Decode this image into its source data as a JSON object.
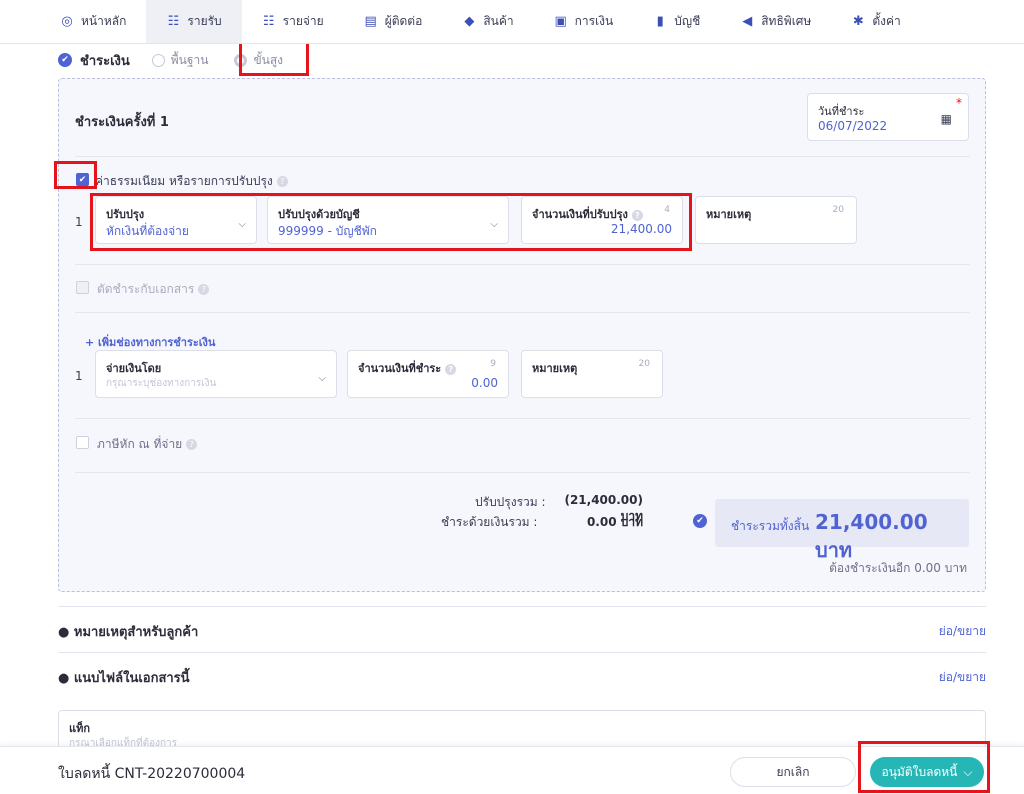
{
  "nav": {
    "items": [
      {
        "label": "หน้าหลัก",
        "icon": "dashboard-icon",
        "glyph": "◎"
      },
      {
        "label": "รายรับ",
        "icon": "income-icon",
        "glyph": "☷"
      },
      {
        "label": "รายจ่าย",
        "icon": "expense-icon",
        "glyph": "☷"
      },
      {
        "label": "ผู้ติดต่อ",
        "icon": "contacts-icon",
        "glyph": "▤"
      },
      {
        "label": "สินค้า",
        "icon": "product-icon",
        "glyph": "◆"
      },
      {
        "label": "การเงิน",
        "icon": "finance-icon",
        "glyph": "▣"
      },
      {
        "label": "บัญชี",
        "icon": "accounting-icon",
        "glyph": "▮"
      },
      {
        "label": "สิทธิพิเศษ",
        "icon": "privilege-icon",
        "glyph": "◀"
      },
      {
        "label": "ตั้งค่า",
        "icon": "settings-icon",
        "glyph": "✱"
      }
    ],
    "active_index": 1
  },
  "payment": {
    "title": "ชำระเงิน",
    "mode_basic": "พื้นฐาน",
    "mode_advanced": "ขั้นสูง",
    "installment_title": "ชำระเงินครั้งที่ 1",
    "date_label": "วันที่ชำระ",
    "date_value": "06/07/2022",
    "adjustment": {
      "checkbox_label": "ค่าธรรมเนียม หรือรายการปรับปรุง",
      "row_number": "1",
      "adjust_label": "ปรับปรุง",
      "adjust_value": "หักเงินที่ต้องจ่าย",
      "account_label": "ปรับปรุงด้วยบัญชี",
      "account_value": "999999 - บัญชีพัก",
      "amount_label": "จำนวนเงินที่ปรับปรุง",
      "amount_count": "4",
      "amount_value": "21,400.00",
      "note_label": "หมายเหตุ",
      "note_count": "20"
    },
    "offset_label": "ตัดชำระกับเอกสาร",
    "add_channel": "+ เพิ่มช่องทางการชำระเงิน",
    "channel": {
      "row_number": "1",
      "paid_by_label": "จ่ายเงินโดย",
      "paid_by_placeholder": "กรุณาระบุช่องทางการเงิน",
      "amount_label": "จำนวนเงินที่ชำระ",
      "amount_count": "9",
      "amount_value": "0.00",
      "note_label": "หมายเหตุ",
      "note_count": "20"
    },
    "withholding_label": "ภาษีหัก ณ ที่จ่าย",
    "summary": {
      "adjust_total_label": "ปรับปรุงรวม :",
      "adjust_total_value": "(21,400.00) บาท",
      "cash_total_label": "ชำระด้วยเงินรวม :",
      "cash_total_value": "0.00 บาท",
      "grand_label": "ชำระรวมทั้งสิ้น",
      "grand_value": "21,400.00 บาท",
      "remaining": "ต้องชำระเงินอีก 0.00 บาท"
    }
  },
  "sections": {
    "customer_note": "● หมายเหตุสำหรับลูกค้า",
    "attachments": "● แนบไฟล์ในเอกสารนี้",
    "toggle": "ย่อ/ขยาย"
  },
  "tag": {
    "label": "แท็ก",
    "placeholder": "กรุณาเลือกแท็กที่ต้องการ"
  },
  "footer": {
    "doc_number": "ใบลดหนี้ CNT-20220700004",
    "cancel": "ยกเลิก",
    "approve": "อนุมัติใบลดหนี้"
  },
  "colors": {
    "accent": "#4f63d2",
    "approve": "#27b6b6",
    "highlight": "#e5141b"
  }
}
